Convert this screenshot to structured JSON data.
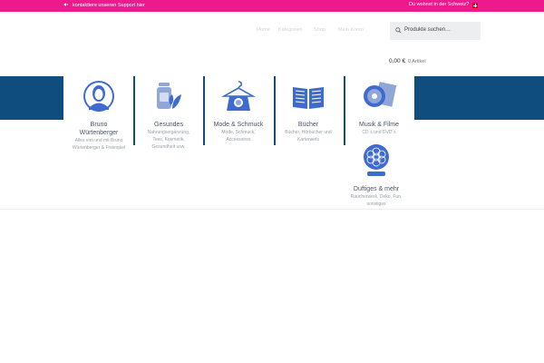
{
  "topbar": {
    "support_text": "kontaktiere unseren Support hier",
    "country_text": "Du wohnst in der Schweiz?",
    "bg_color": "#ec1a8c"
  },
  "nav": {
    "items": [
      "Home",
      "Kategorien",
      "Shop",
      "Mein Konto"
    ]
  },
  "search": {
    "placeholder": "Produkte suchen…"
  },
  "cart": {
    "amount": "0,00 €",
    "items": "0 Artikel"
  },
  "categories": [
    {
      "title_lines": [
        "Bruno",
        "Würtenberger"
      ],
      "desc_lines": [
        "Alles von und mit Bruno",
        "Würtenberger & Freiespiel"
      ],
      "icon": "portrait-icon"
    },
    {
      "title_lines": [
        "Gesundes"
      ],
      "desc_lines": [
        "Nahrungsergänzung,",
        "Tees, Kosmetik,",
        "Gesundheit usw."
      ],
      "icon": "jar-leaf-icon"
    },
    {
      "title_lines": [
        "Mode & Schmuck"
      ],
      "desc_lines": [
        "Mode, Schmuck,",
        "Accessoires"
      ],
      "icon": "clothes-hanger-icon"
    },
    {
      "title_lines": [
        "Bücher"
      ],
      "desc_lines": [
        "Bücher, Hörbücher und",
        "Kartensets"
      ],
      "icon": "open-book-icon"
    },
    {
      "title_lines": [
        "Musik & Filme"
      ],
      "desc_lines": [
        "CD´s und DVD´s"
      ],
      "icon": "cd-film-icon"
    },
    {
      "title_lines": [
        "Duftiges & mehr"
      ],
      "desc_lines": [
        "Räucherwerk, Deko, Fun,",
        "sonstiges"
      ],
      "icon": "incense-icon"
    }
  ],
  "colors": {
    "band": "#0f4d7f",
    "icon_blue": "#3f6bd1",
    "icon_light": "#8fa6d6",
    "icon_green": "#3f6bd1"
  }
}
